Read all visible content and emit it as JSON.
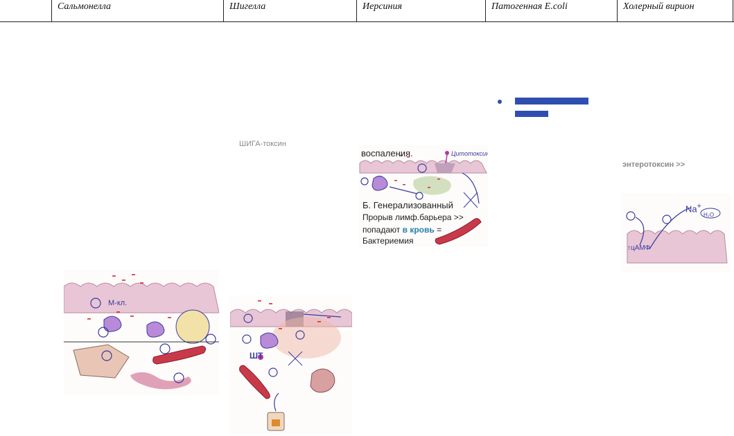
{
  "header": {
    "columns": [
      {
        "id": "salmonella",
        "label": "Сальмонелла"
      },
      {
        "id": "shigella",
        "label": "Шигелла"
      },
      {
        "id": "yersinia",
        "label": "Иерсиния"
      },
      {
        "id": "ecoli",
        "label": "Патогенная E.coli"
      },
      {
        "id": "cholera",
        "label": "Холерный вирион"
      }
    ]
  },
  "labels": {
    "shiga_toxin": "ШИГА-токсин",
    "enterotoxin": "энтеротоксин >>"
  },
  "yersinia_figure": {
    "top_line": "воспаления.",
    "cytotoxin": "Цитотоксин",
    "heading": "Б. Генерализованный",
    "line2": "Прорыв лимф.барьера >>",
    "line3_pre": "попадают",
    "line3_bold": "в кровь",
    "line3_post": "=",
    "line4": "Бактериемия"
  },
  "cholera_figure": {
    "na": "Na",
    "plus": "+",
    "h2o": "H₂O",
    "camp": "↑цАМФ"
  },
  "salmonella_figure": {
    "m_cell": "М-кл."
  },
  "shigella_figure": {
    "st": "ШТ"
  },
  "colors": {
    "cell_fill": "#e8c6d6",
    "bacteria": "#d42a3a",
    "ink": "#3a3aa0",
    "vessel": "#c83a4a",
    "bullet": "#2f4fb0"
  }
}
